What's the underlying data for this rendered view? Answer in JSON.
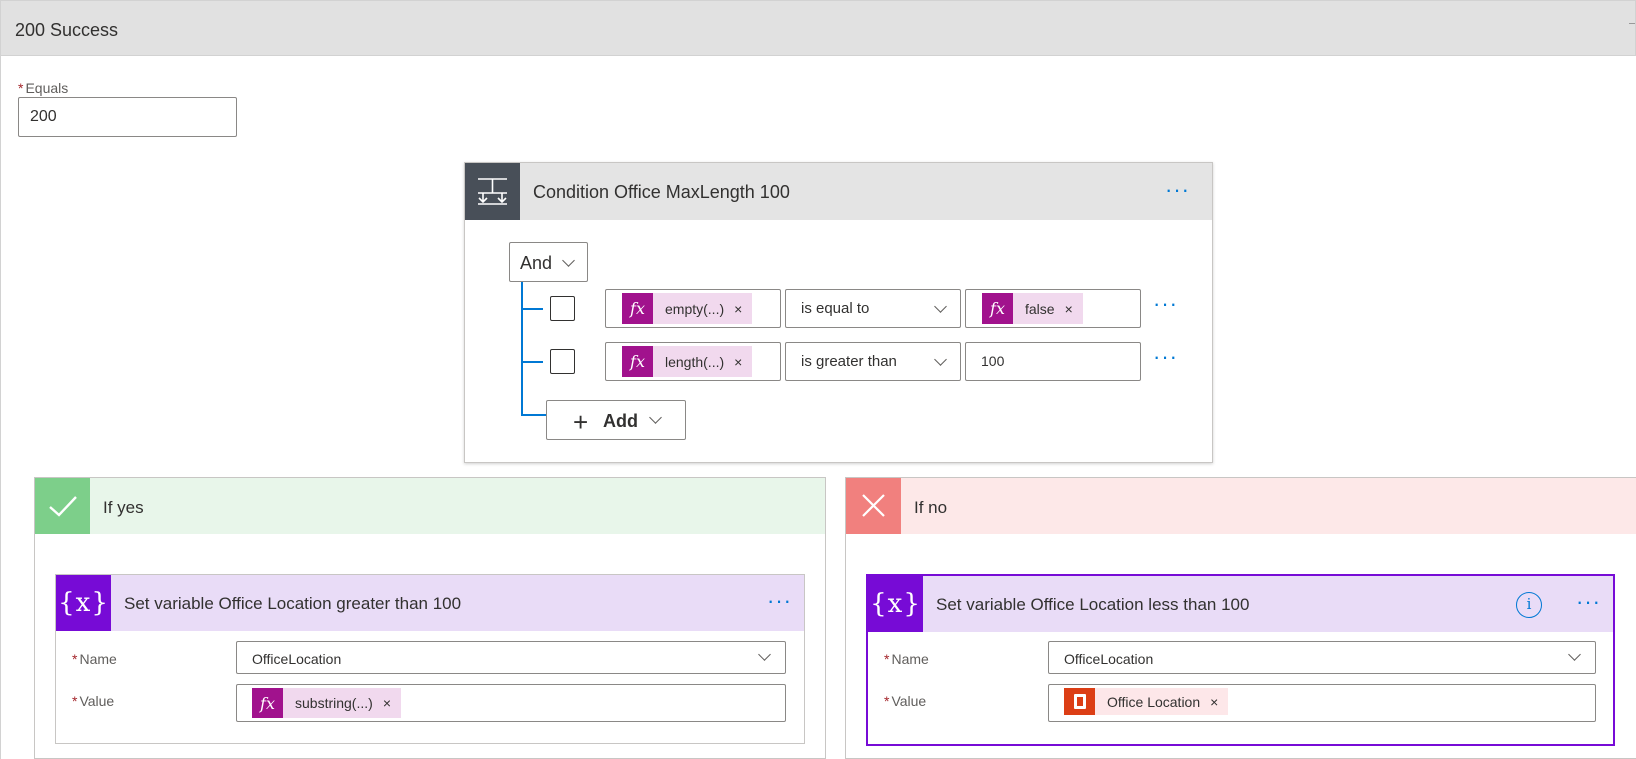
{
  "case": {
    "title": "200 Success"
  },
  "equals": {
    "label": "Equals",
    "required_mark": "*",
    "value": "200"
  },
  "condition": {
    "title": "Condition Office MaxLength 100",
    "group_operator": "And",
    "rows": [
      {
        "left_token": "empty(...)",
        "operator": "is equal to",
        "right_token": "false",
        "right_value": ""
      },
      {
        "left_token": "length(...)",
        "operator": "is greater than",
        "right_token": "",
        "right_value": "100"
      }
    ],
    "add_label": "Add"
  },
  "if_yes": {
    "title": "If yes",
    "action": {
      "title": "Set variable Office Location greater than 100",
      "name_label": "Name",
      "name_value": "OfficeLocation",
      "value_label": "Value",
      "value_token": "substring(...)"
    }
  },
  "if_no": {
    "title": "If no",
    "action": {
      "title": "Set variable Office Location less than 100",
      "name_label": "Name",
      "name_value": "OfficeLocation",
      "value_label": "Value",
      "value_token": "Office Location"
    }
  },
  "icons": {
    "fx": "fx",
    "variable": "{x}",
    "remove": "×",
    "more": "···",
    "info": "i",
    "plus": "+"
  },
  "colors": {
    "accent": "#0078d4",
    "expression": "#a1128d",
    "expression_token_bg": "#f1d9ee",
    "variable": "#770bd6",
    "variable_header_bg": "#e9dcf7",
    "yes_header_bg": "#e8f6ea",
    "yes_icon_bg": "#7dcf8a",
    "no_header_bg": "#fde8e8",
    "no_icon_bg": "#f1807e",
    "office": "#dc3e15"
  }
}
